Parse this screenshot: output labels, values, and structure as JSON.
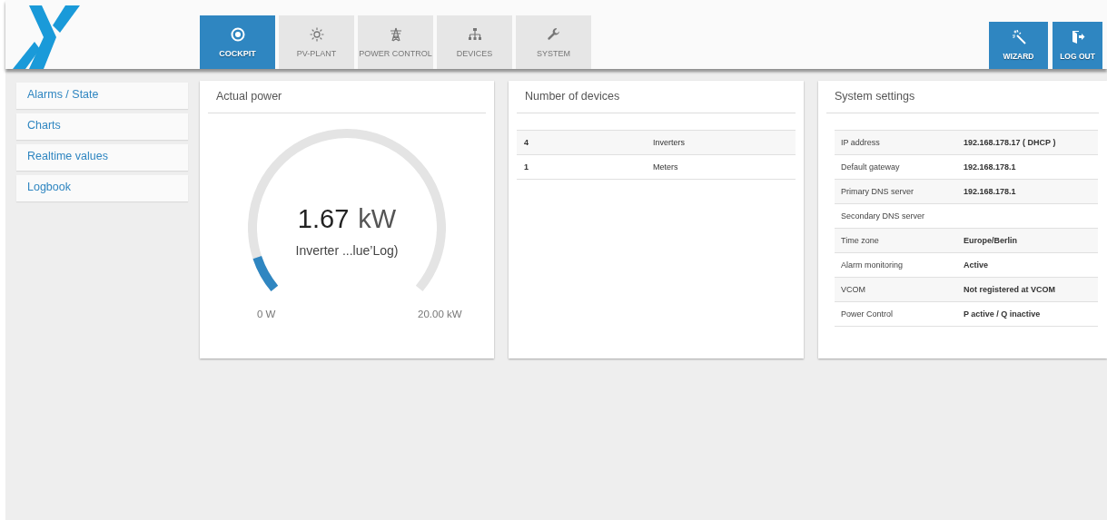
{
  "tabs": [
    {
      "label": "COCKPIT",
      "kind": "target",
      "selected": true
    },
    {
      "label": "PV-PLANT",
      "kind": "sun",
      "selected": false
    },
    {
      "label": "POWER CONTROL",
      "kind": "tower",
      "selected": false
    },
    {
      "label": "DEVICES",
      "kind": "network",
      "selected": false
    },
    {
      "label": "SYSTEM",
      "kind": "wrench",
      "selected": false
    }
  ],
  "actions": [
    {
      "label": "WIZARD",
      "kind": "wand"
    },
    {
      "label": "LOG OUT",
      "kind": "exit"
    }
  ],
  "sidebar": {
    "items": [
      "Alarms / State",
      "Charts",
      "Realtime values",
      "Logbook"
    ]
  },
  "actual_power": {
    "title": "Actual power",
    "value": "1.67",
    "unit": "kW",
    "caption": "Inverter ...lue’Log)",
    "level": 0.0835,
    "min_label": "0 W",
    "max_label": "20.00 kW"
  },
  "devices": {
    "title": "Number of devices",
    "rows": [
      {
        "count": "4",
        "type": "Inverters"
      },
      {
        "count": "1",
        "type": "Meters"
      }
    ]
  },
  "system_settings": {
    "title": "System settings",
    "rows": [
      {
        "label": "IP address",
        "value": "192.168.178.17 ( DHCP )"
      },
      {
        "label": "Default gateway",
        "value": "192.168.178.1"
      },
      {
        "label": "Primary DNS server",
        "value": "192.168.178.1"
      },
      {
        "label": "Secondary DNS server"
      },
      {
        "label": "Time zone",
        "value": "Europe/Berlin"
      },
      {
        "label": "Alarm monitoring",
        "value": "Active"
      },
      {
        "label": "VCOM",
        "value": "Not registered at VCOM"
      },
      {
        "label": "Power Control",
        "value": "P active / Q inactive"
      }
    ]
  }
}
